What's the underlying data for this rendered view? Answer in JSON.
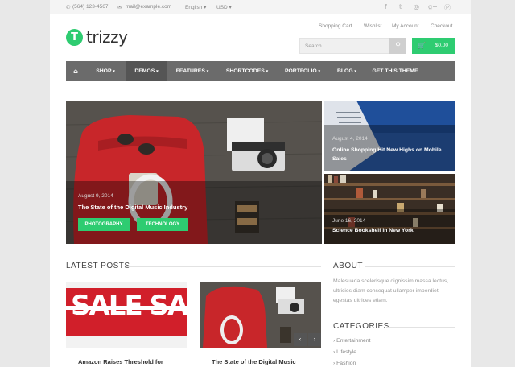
{
  "topbar": {
    "phone": "(564) 123-4567",
    "email": "mail@example.com",
    "language": "English",
    "currency": "USD",
    "social_icons": [
      "facebook-icon",
      "twitter-icon",
      "dribbble-icon",
      "google-plus-icon",
      "pinterest-icon"
    ]
  },
  "brand": {
    "logo_letter": "T",
    "name": "trizzy",
    "accent": "#2ecc71"
  },
  "toplinks": [
    "Shopping Cart",
    "Wishlist",
    "My Account",
    "Checkout"
  ],
  "search": {
    "placeholder": "Search"
  },
  "cart": {
    "amount": "$0.00"
  },
  "nav": {
    "items": [
      {
        "label": "SHOP",
        "dropdown": true
      },
      {
        "label": "DEMOS",
        "dropdown": true,
        "active": true
      },
      {
        "label": "FEATURES",
        "dropdown": true
      },
      {
        "label": "SHORTCODES",
        "dropdown": true
      },
      {
        "label": "PORTFOLIO",
        "dropdown": true
      },
      {
        "label": "BLOG",
        "dropdown": true
      },
      {
        "label": "GET THIS THEME",
        "dropdown": false
      }
    ]
  },
  "slider": {
    "main": {
      "date": "August 9, 2014",
      "title": "The State of the Digital Music Industry",
      "tags": [
        "PHOTOGRAPHY",
        "TECHNOLOGY"
      ]
    },
    "side": [
      {
        "date": "August 4, 2014",
        "title": "Online Shopping Hit New Highs on Mobile Sales"
      },
      {
        "date": "June 16, 2014",
        "title": "Science Bookshelf in New York"
      }
    ]
  },
  "latest": {
    "heading": "LATEST POSTS",
    "posts": [
      {
        "title": "Amazon Raises Threshold for",
        "image_text": "SALE SALE"
      },
      {
        "title": "The State of the Digital Music"
      }
    ]
  },
  "sidebar": {
    "about_heading": "ABOUT",
    "about_text": "Malesuada scelerisque dignissim massa lectus, ultricies diam consequat ullamper imperdiet egestas ultrices etiam.",
    "categories_heading": "CATEGORIES",
    "categories": [
      "Entertainment",
      "Lifestyle",
      "Fashion"
    ]
  }
}
